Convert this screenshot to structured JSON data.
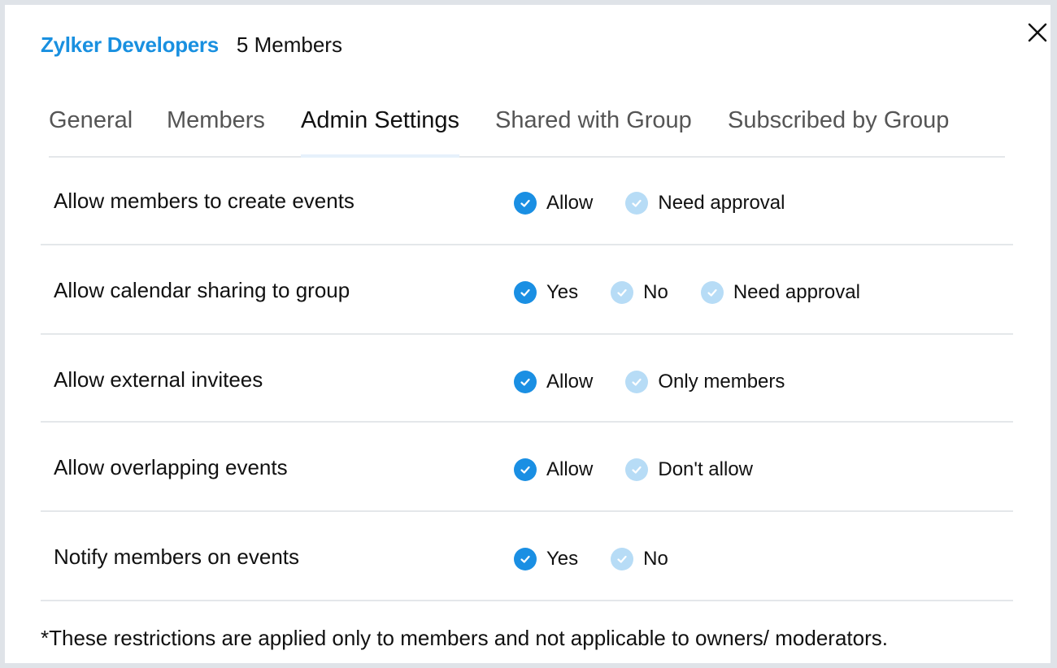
{
  "header": {
    "group_name": "Zylker Developers",
    "member_count": "5 Members"
  },
  "tabs": [
    {
      "label": "General",
      "active": false
    },
    {
      "label": "Members",
      "active": false
    },
    {
      "label": "Admin Settings",
      "active": true
    },
    {
      "label": "Shared with Group",
      "active": false
    },
    {
      "label": "Subscribed by Group",
      "active": false
    }
  ],
  "settings": [
    {
      "label": "Allow members to create events",
      "options": [
        {
          "label": "Allow",
          "selected": true
        },
        {
          "label": "Need approval",
          "selected": false
        }
      ]
    },
    {
      "label": "Allow calendar sharing to group",
      "options": [
        {
          "label": "Yes",
          "selected": true
        },
        {
          "label": "No",
          "selected": false
        },
        {
          "label": "Need approval",
          "selected": false
        }
      ]
    },
    {
      "label": "Allow external invitees",
      "options": [
        {
          "label": "Allow",
          "selected": true
        },
        {
          "label": "Only members",
          "selected": false
        }
      ]
    },
    {
      "label": "Allow overlapping events",
      "options": [
        {
          "label": "Allow",
          "selected": true
        },
        {
          "label": "Don't allow",
          "selected": false
        }
      ]
    },
    {
      "label": "Notify members on events",
      "options": [
        {
          "label": "Yes",
          "selected": true
        },
        {
          "label": "No",
          "selected": false
        }
      ]
    }
  ],
  "footnote": "*These restrictions are applied only to members and not applicable to owners/ moderators.",
  "colors": {
    "accent": "#1990e0",
    "check_selected": "#1a8fe3",
    "check_unselected": "#b7dcf6",
    "divider": "#e4e7ea"
  },
  "icons": {
    "close": "close-icon",
    "check": "check-circle-icon"
  }
}
